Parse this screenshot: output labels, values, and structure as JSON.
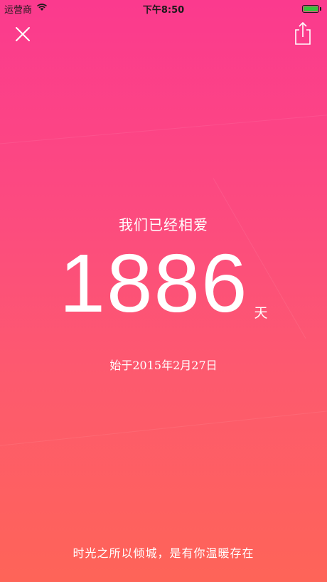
{
  "status_bar": {
    "carrier": "运营商",
    "time": "下午8:50",
    "battery_level": 1.0
  },
  "toolbar": {
    "close_icon": "close-icon",
    "share_icon": "share-icon"
  },
  "main": {
    "headline": "我们已经相爱",
    "days_count": "1886",
    "days_unit": "天",
    "since_date": "始于2015年2月27日"
  },
  "footer": {
    "quote": "时光之所以倾城，是有你温暖存在"
  },
  "colors": {
    "gradient_top": "#fb3a8e",
    "gradient_bottom": "#fe6458",
    "battery_green": "#35c43a"
  }
}
